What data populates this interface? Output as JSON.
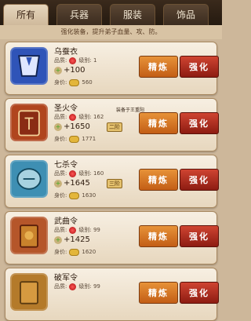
{
  "tabs": [
    "所有",
    "兵器",
    "服装",
    "饰品"
  ],
  "subtitle": "强化装备，提升弟子血量、攻、防。",
  "labels": {
    "quality": "品质:",
    "level": "级别:",
    "price": "身价:"
  },
  "buttons": {
    "refine": "精炼",
    "enhance": "强化"
  },
  "note": "装备于王重阳",
  "items": [
    {
      "name": "乌蚕衣",
      "level": "1",
      "stat": "+100",
      "rank": "",
      "price": "560",
      "icon_color": "#2f54b8",
      "icon": "armor-icon"
    },
    {
      "name": "圣火令",
      "level": "162",
      "stat": "+1650",
      "rank": "二阶",
      "price": "1771",
      "icon_color": "#b0451e",
      "icon": "token-icon"
    },
    {
      "name": "七杀令",
      "level": "160",
      "stat": "+1645",
      "rank": "三阶",
      "price": "1630",
      "icon_color": "#3e8fb3",
      "icon": "token-icon"
    },
    {
      "name": "武曲令",
      "level": "99",
      "stat": "+1425",
      "rank": "",
      "price": "1620",
      "icon_color": "#b5562a",
      "icon": "token-icon"
    },
    {
      "name": "破军令",
      "level": "99",
      "stat": "",
      "rank": "",
      "price": "",
      "icon_color": "#b47a2a",
      "icon": "token-icon"
    }
  ]
}
